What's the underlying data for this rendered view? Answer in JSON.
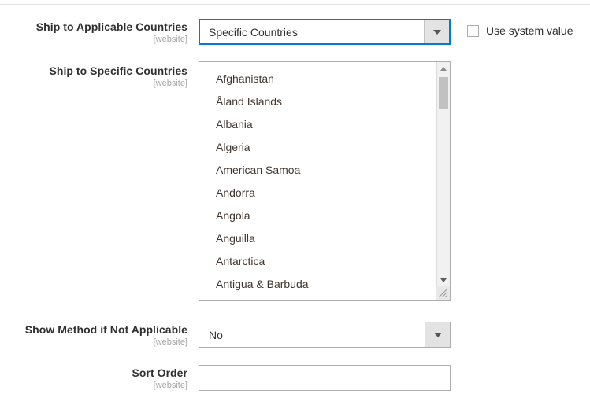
{
  "form": {
    "fields": [
      {
        "id": "ship-to-applicable-countries",
        "label": "Ship to Applicable Countries",
        "scope": "[website]",
        "type": "select",
        "value": "Specific Countries",
        "focused": true,
        "system_value": {
          "label": "Use system value",
          "checked": false
        }
      },
      {
        "id": "ship-to-specific-countries",
        "label": "Ship to Specific Countries",
        "scope": "[website]",
        "type": "multiselect",
        "options": [
          "Afghanistan",
          "Åland Islands",
          "Albania",
          "Algeria",
          "American Samoa",
          "Andorra",
          "Angola",
          "Anguilla",
          "Antarctica",
          "Antigua & Barbuda"
        ],
        "selected": []
      },
      {
        "id": "show-method-if-not-applicable",
        "label": "Show Method if Not Applicable",
        "scope": "[website]",
        "type": "select",
        "value": "No",
        "focused": false
      },
      {
        "id": "sort-order",
        "label": "Sort Order",
        "scope": "[website]",
        "type": "text",
        "value": "",
        "placeholder": ""
      }
    ]
  },
  "icons": {
    "caret_down": "chevron-down-icon",
    "scroll_up": "scroll-up-arrow-icon",
    "scroll_down": "scroll-down-arrow-icon",
    "resize_grip": "resize-grip-icon"
  },
  "colors": {
    "accent": "#007bdb",
    "border": "#adadad",
    "label": "#303030",
    "scope_text": "#a6a6a6",
    "option_text": "#41362f",
    "button_face": "#e3e3e3",
    "scrollbar_track": "#f1f1f1",
    "scrollbar_thumb": "#c1c1c1"
  }
}
